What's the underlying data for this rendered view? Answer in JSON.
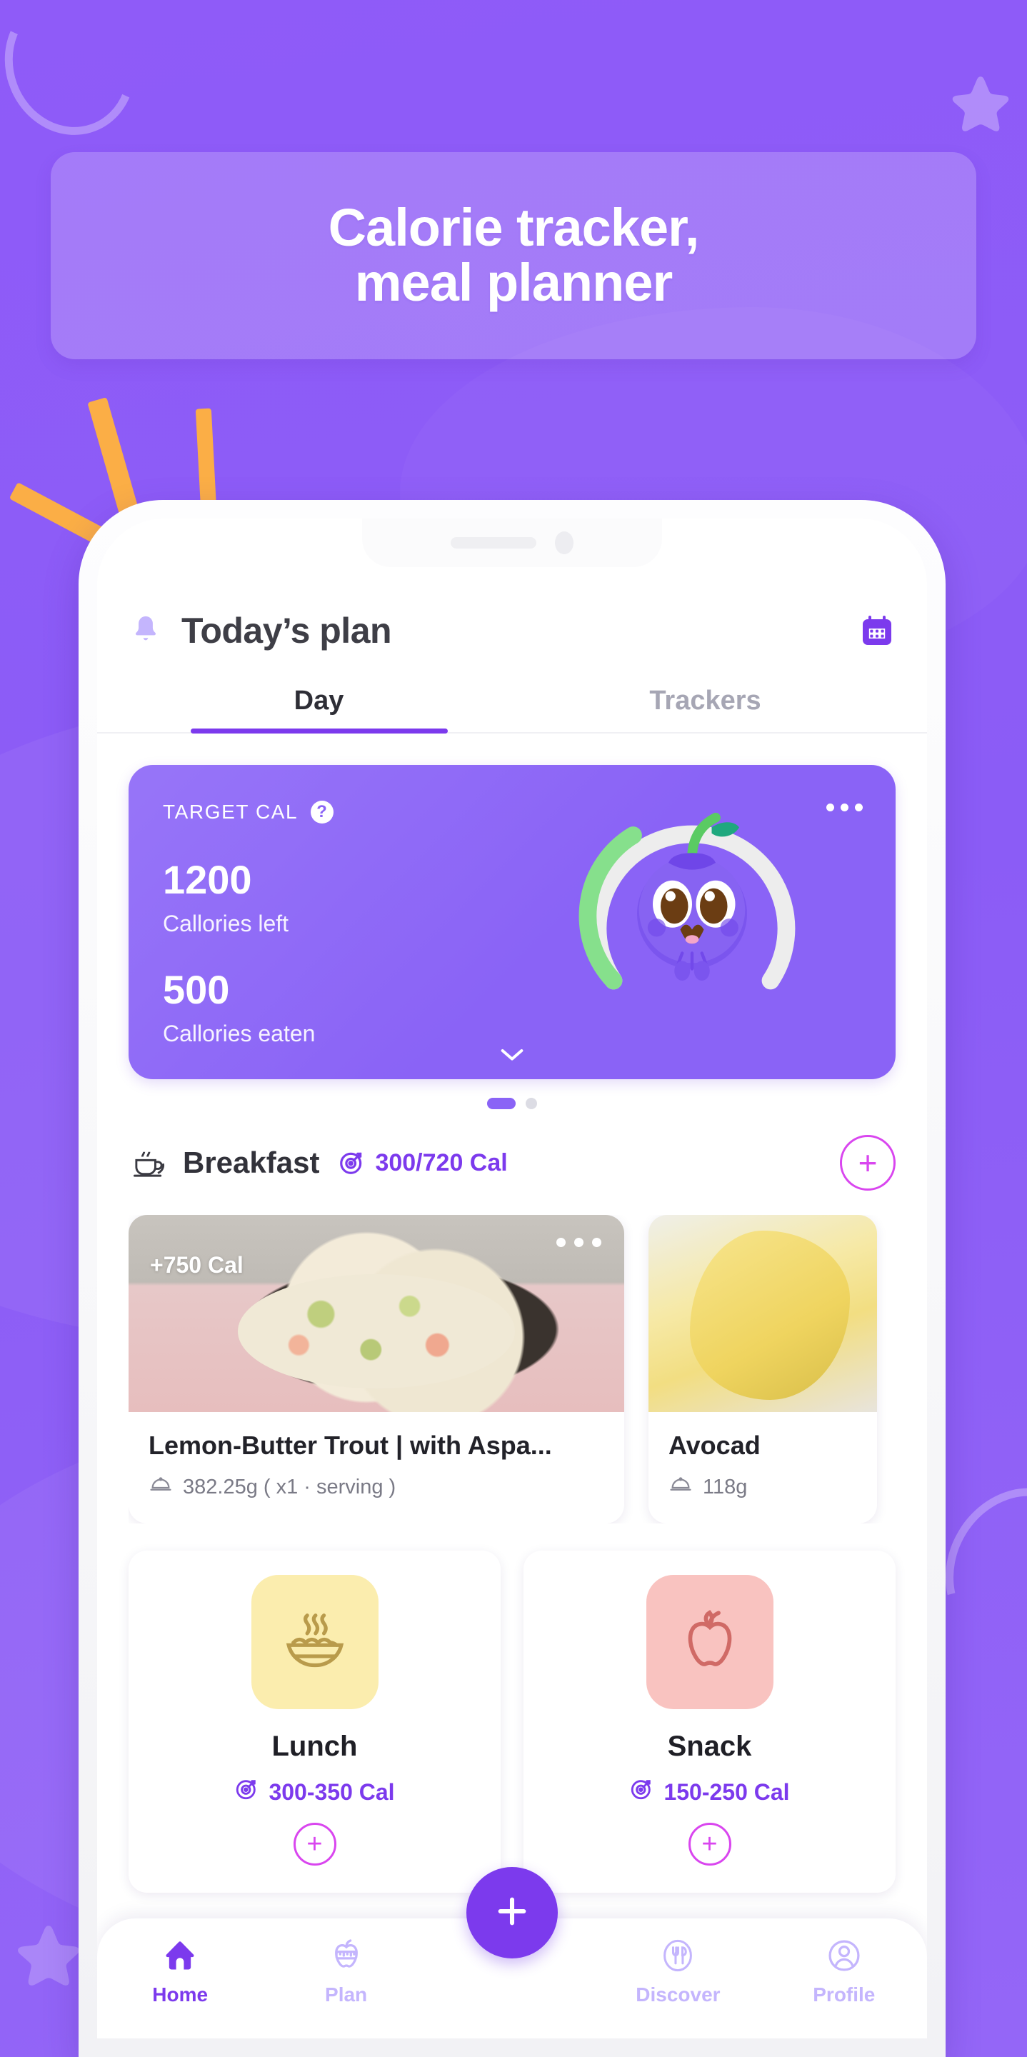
{
  "headline": {
    "line1": "Calorie tracker,",
    "line2": "meal planner"
  },
  "colors": {
    "background": "#8B5CF6",
    "banner": "rgba(255,255,255,0.20)",
    "accent": "#7C3AED",
    "card": "#8A63F6",
    "ring_progress": "#86E08C",
    "ring_track": "#EDEDED",
    "pink_accent": "#D946EF",
    "burst": "#FBAE46"
  },
  "app": {
    "header": {
      "bell_icon": "bell-icon",
      "title": "Today’s plan",
      "calendar_icon": "calendar-icon"
    },
    "tabs": [
      {
        "label": "Day",
        "active": true
      },
      {
        "label": "Trackers",
        "active": false
      }
    ],
    "calorie_card": {
      "label": "TARGET CAL",
      "help_badge": "?",
      "calories_left_value": "1200",
      "calories_left_label": "Callories left",
      "calories_eaten_value": "500",
      "calories_eaten_label": "Callories eaten",
      "more_icon": "more-horizontal-icon",
      "expand_icon": "chevron-down-icon",
      "mascot": "blueberry-mascot-icon"
    },
    "pager": {
      "active_index": 0,
      "count": 2
    },
    "breakfast": {
      "icon": "coffee-cup-icon",
      "name": "Breakfast",
      "target_icon": "target-icon",
      "calories": "300/720 Cal",
      "add_icon": "plus-icon"
    },
    "food_cards": [
      {
        "badge": "+750 Cal",
        "title": "Lemon-Butter Trout | with Aspa...",
        "meta": "382.25g ( x1 · serving )",
        "dish_icon": "cloche-icon",
        "more_icon": "more-horizontal-icon",
        "image": "trout-rice-bowl-photo"
      },
      {
        "badge": "",
        "title": "Avocad",
        "meta": "118g",
        "dish_icon": "cloche-icon",
        "more_icon": "",
        "image": "banana-photo"
      }
    ],
    "meal_cards": [
      {
        "name": "Lunch",
        "icon": "hot-bowl-icon",
        "target_icon": "target-icon",
        "calories": "300-350 Cal",
        "add_icon": "plus-icon"
      },
      {
        "name": "Snack",
        "icon": "apple-icon",
        "target_icon": "target-icon",
        "calories": "150-250 Cal",
        "add_icon": "plus-icon"
      }
    ],
    "nav": [
      {
        "label": "Home",
        "icon": "home-icon",
        "active": true
      },
      {
        "label": "Plan",
        "icon": "apple-measure-icon",
        "active": false
      },
      {
        "label": "Discover",
        "icon": "fork-spoon-icon",
        "active": false
      },
      {
        "label": "Profile",
        "icon": "user-circle-icon",
        "active": false
      }
    ],
    "fab": {
      "icon": "plus-icon"
    }
  }
}
